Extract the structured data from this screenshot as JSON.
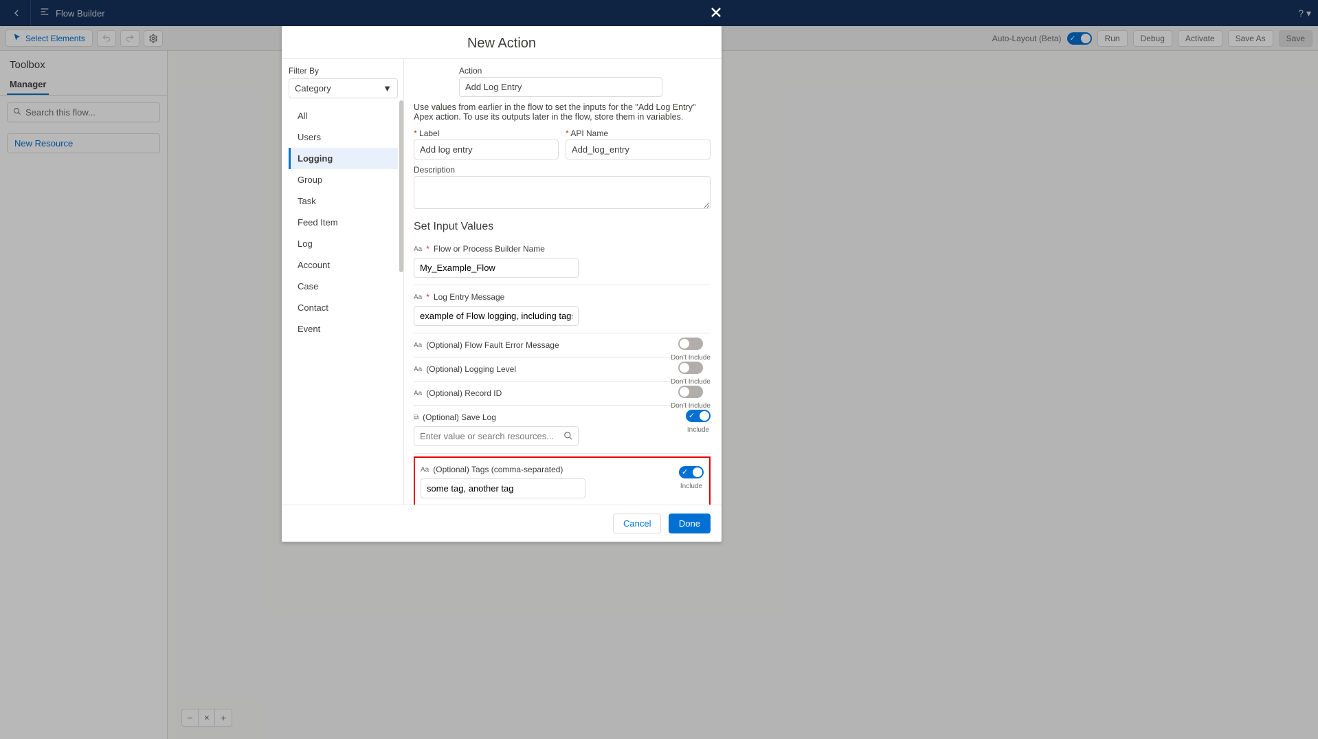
{
  "header": {
    "title": "Flow Builder",
    "help": "?"
  },
  "toolbar": {
    "select_elements": "Select Elements",
    "auto_layout": "Auto-Layout (Beta)",
    "run": "Run",
    "debug": "Debug",
    "activate": "Activate",
    "save_as": "Save As",
    "save": "Save"
  },
  "sidebar": {
    "title": "Toolbox",
    "tab": "Manager",
    "search_placeholder": "Search this flow...",
    "new_resource": "New Resource"
  },
  "modal": {
    "title": "New Action",
    "filter_by": "Filter By",
    "filter_value": "Category",
    "categories": [
      "All",
      "Users",
      "Logging",
      "Group",
      "Task",
      "Feed Item",
      "Log",
      "Account",
      "Case",
      "Contact",
      "Event"
    ],
    "active_category": "Logging",
    "action_label": "Action",
    "action_value": "Add Log Entry",
    "instructions": "Use values from earlier in the flow to set the inputs for the \"Add Log Entry\" Apex action. To use its outputs later in the flow, store them in variables.",
    "label_label": "Label",
    "label_value": "Add log entry",
    "api_label": "API Name",
    "api_value": "Add_log_entry",
    "desc_label": "Description",
    "section": "Set Input Values",
    "inputs": {
      "flow_name": {
        "label": "Flow or Process Builder Name",
        "required": true,
        "value": "My_Example_Flow"
      },
      "message": {
        "label": "Log Entry Message",
        "required": true,
        "value": "example of Flow logging, including tags"
      },
      "fault": {
        "label": "(Optional) Flow Fault Error Message",
        "include": false,
        "caption": "Don't Include"
      },
      "level": {
        "label": "(Optional) Logging Level",
        "include": false,
        "caption": "Don't Include"
      },
      "record": {
        "label": "(Optional) Record ID",
        "include": false,
        "caption": "Don't Include"
      },
      "save": {
        "label": "(Optional) Save Log",
        "include": true,
        "caption": "Include",
        "placeholder": "Enter value or search resources..."
      },
      "tags": {
        "label": "(Optional) Tags (comma-separated)",
        "include": true,
        "caption": "Include",
        "value": "some tag, another tag"
      }
    },
    "cancel": "Cancel",
    "done": "Done"
  }
}
